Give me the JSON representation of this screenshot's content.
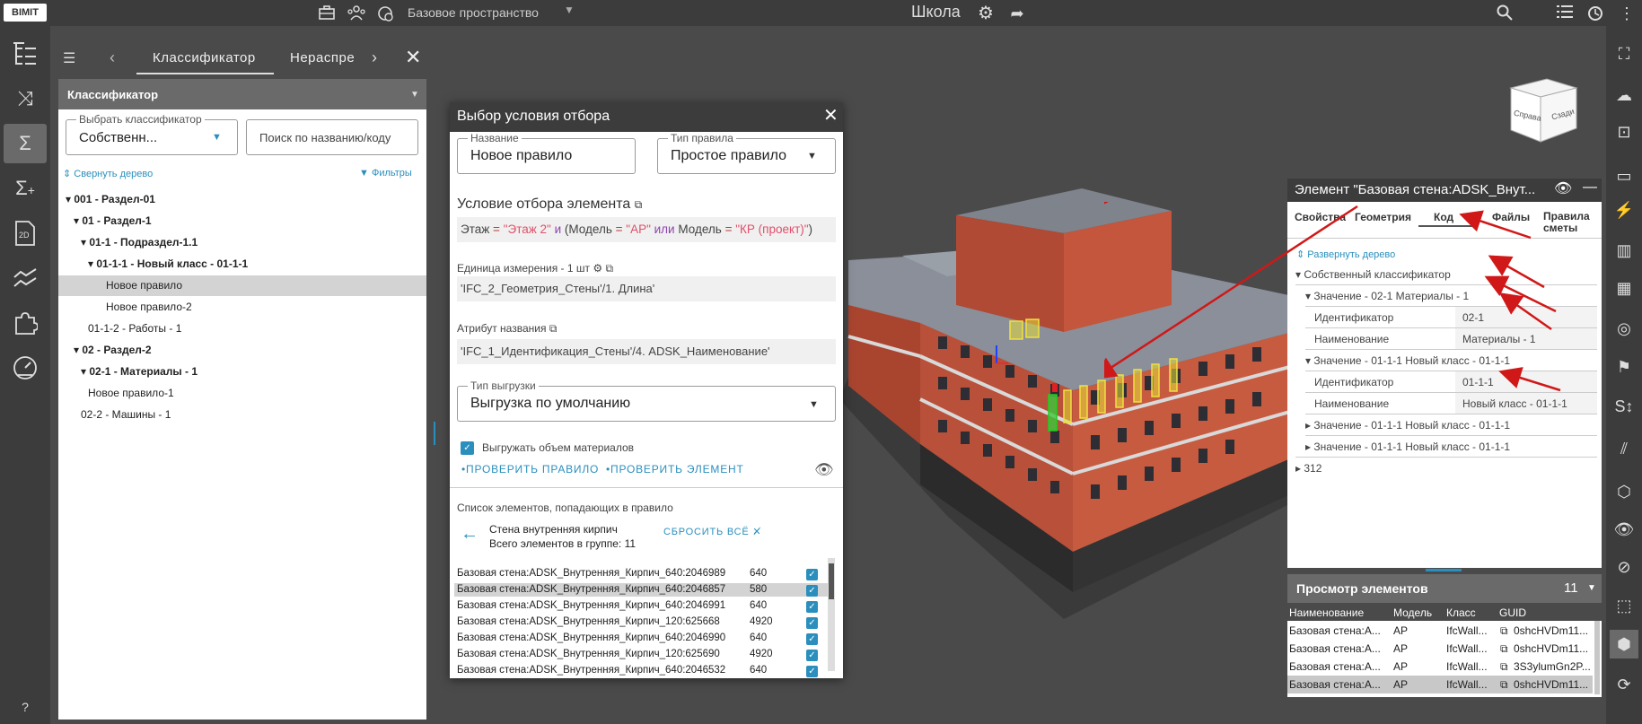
{
  "topbar": {
    "logo": "BIMIT",
    "space": "Базовое пространство",
    "title": "Школа",
    "icons": [
      "briefcase-icon",
      "people-icon",
      "settings-sub-icon",
      "gear-icon",
      "share-icon",
      "search-icon",
      "list-icon",
      "sync-icon",
      "menu-dots-icon"
    ]
  },
  "left_toolbar": {
    "icons": [
      "tree-structure-icon",
      "shuffle-icon",
      "sigma-icon",
      "sigma-plus-icon",
      "2d-icon",
      "chart-line-icon",
      "puzzle-icon",
      "gauge-icon"
    ],
    "active": "sigma-icon",
    "help": "?"
  },
  "left_panel": {
    "tabs": [
      "Классификатор",
      "Нераспре"
    ],
    "section": "Классификатор",
    "classifier_legend": "Выбрать классификатор",
    "classifier_value": "Собственн...",
    "search_placeholder": "Поиск по названию/коду",
    "collapse": "Свернуть дерево",
    "filters": "Фильтры",
    "tree": [
      {
        "label": "001 - Раздел-01",
        "level": 0,
        "bold": true,
        "expanded": true
      },
      {
        "label": "01 - Раздел-1",
        "level": 1,
        "bold": true,
        "expanded": true
      },
      {
        "label": "01-1 - Подраздел-1.1",
        "level": 2,
        "bold": true,
        "expanded": true
      },
      {
        "label": "01-1-1 - Новый класс - 01-1-1",
        "level": 3,
        "bold": true,
        "expanded": true
      },
      {
        "label": "Новое правило",
        "level": 4,
        "bold": false,
        "selected": true
      },
      {
        "label": "Новое правило-2",
        "level": 4,
        "bold": false
      },
      {
        "label": "01-1-2 - Работы - 1",
        "level": 3,
        "bold": false
      },
      {
        "label": "02 - Раздел-2",
        "level": 1,
        "bold": true,
        "expanded": true
      },
      {
        "label": "02-1 - Материалы - 1",
        "level": 2,
        "bold": true,
        "expanded": true
      },
      {
        "label": "Новое правило-1",
        "level": 3,
        "bold": false
      },
      {
        "label": "02-2 - Машины - 1",
        "level": 2,
        "bold": false
      }
    ]
  },
  "modal": {
    "title": "Выбор условия отбора",
    "name_legend": "Название",
    "name_value": "Новое правило",
    "rule_type_legend": "Тип правила",
    "rule_type_value": "Простое правило",
    "condition_title": "Условие отбора элемента",
    "condition": {
      "p1": "Этаж",
      "eq": "=",
      "v1": "\"Этаж 2\"",
      "and": "и",
      "p2": "(Модель",
      "v2": "\"АР\"",
      "or": "или",
      "p3": "Модель",
      "v3": "\"КР (проект)\"",
      "close": ")"
    },
    "unit_label": "Единица измерения - 1 шт",
    "unit_value": "'IFC_2_Геометрия_Стены'/1. Длина'",
    "name_attr_label": "Атрибут названия",
    "name_attr_value": "'IFC_1_Идентификация_Стены'/4. ADSK_Наименование'",
    "export_legend": "Тип выгрузки",
    "export_value": "Выгрузка по умолчанию",
    "export_volume": "Выгружать объем материалов",
    "btn_check_rule": "ПРОВЕРИТЬ ПРАВИЛО",
    "btn_check_element": "ПРОВЕРИТЬ ЭЛЕМЕНТ",
    "list_title": "Список элементов, попадающих в правило",
    "group_name": "Стена внутренняя кирпич",
    "group_total": "Всего элементов в группе: 11",
    "reset_all": "СБРОСИТЬ ВСЁ",
    "items": [
      {
        "name": "Базовая стена:ADSK_Внутренняя_Кирпич_640:2046989",
        "value": "640"
      },
      {
        "name": "Базовая стена:ADSK_Внутренняя_Кирпич_640:2046857",
        "value": "580",
        "selected": true
      },
      {
        "name": "Базовая стена:ADSK_Внутренняя_Кирпич_640:2046991",
        "value": "640"
      },
      {
        "name": "Базовая стена:ADSK_Внутренняя_Кирпич_120:625668",
        "value": "4920"
      },
      {
        "name": "Базовая стена:ADSK_Внутренняя_Кирпич_640:2046990",
        "value": "640"
      },
      {
        "name": "Базовая стена:ADSK_Внутренняя_Кирпич_120:625690",
        "value": "4920"
      },
      {
        "name": "Базовая стена:ADSK_Внутренняя_Кирпич_640:2046532",
        "value": "640"
      }
    ]
  },
  "element_panel": {
    "title": "Элемент \"Базовая стена:ADSK_Внут...",
    "tabs": [
      "Свойства",
      "Геометрия",
      "Код",
      "Файлы",
      "Правила сметы"
    ],
    "active_tab": "Код",
    "expand": "Развернуть дерево",
    "classifier": "Собственный классификатор",
    "value1": "Значение - 02-1 Материалы - 1",
    "id_label": "Идентификатор",
    "name_label": "Наименование",
    "id1": "02-1",
    "name1": "Материалы - 1",
    "value2": "Значение - 01-1-1 Новый класс - 01-1-1",
    "id2": "01-1-1",
    "name2": "Новый класс - 01-1-1",
    "value3": "Значение - 01-1-1 Новый класс - 01-1-1",
    "value4": "Значение - 01-1-1 Новый класс - 01-1-1",
    "other": "312"
  },
  "view_panel": {
    "title": "Просмотр элементов",
    "count": "11",
    "columns": [
      "Наименование",
      "Модель",
      "Класс",
      "GUID"
    ],
    "rows": [
      {
        "name": "Базовая стена:А...",
        "model": "АР",
        "cls": "IfcWall...",
        "guid": "0shcHVDm11..."
      },
      {
        "name": "Базовая стена:А...",
        "model": "АР",
        "cls": "IfcWall...",
        "guid": "0shcHVDm11..."
      },
      {
        "name": "Базовая стена:А...",
        "model": "АР",
        "cls": "IfcWall...",
        "guid": "3S3ylumGn2P..."
      },
      {
        "name": "Базовая стена:А...",
        "model": "АР",
        "cls": "IfcWall...",
        "guid": "0shcHVDm11...",
        "selected": true
      }
    ]
  },
  "viewcube": {
    "left": "Справа",
    "right": "Сзади"
  },
  "right_toolbar": {
    "icons": [
      "focus-icon",
      "cloud-upload-icon",
      "zoom-area-icon",
      "measure-ruler-icon",
      "section-plane-icon",
      "layers-icon",
      "sheets-icon",
      "target-icon",
      "flag-icon",
      "scale-icon",
      "clip-icon",
      "box-icon",
      "eye-icon",
      "eye-off-icon",
      "select-box-icon",
      "cube-icon",
      "orbit-icon"
    ]
  },
  "colors": {
    "accent": "#2a8fbd",
    "dark": "#3c3c3c",
    "bg": "#4a4a4a"
  }
}
